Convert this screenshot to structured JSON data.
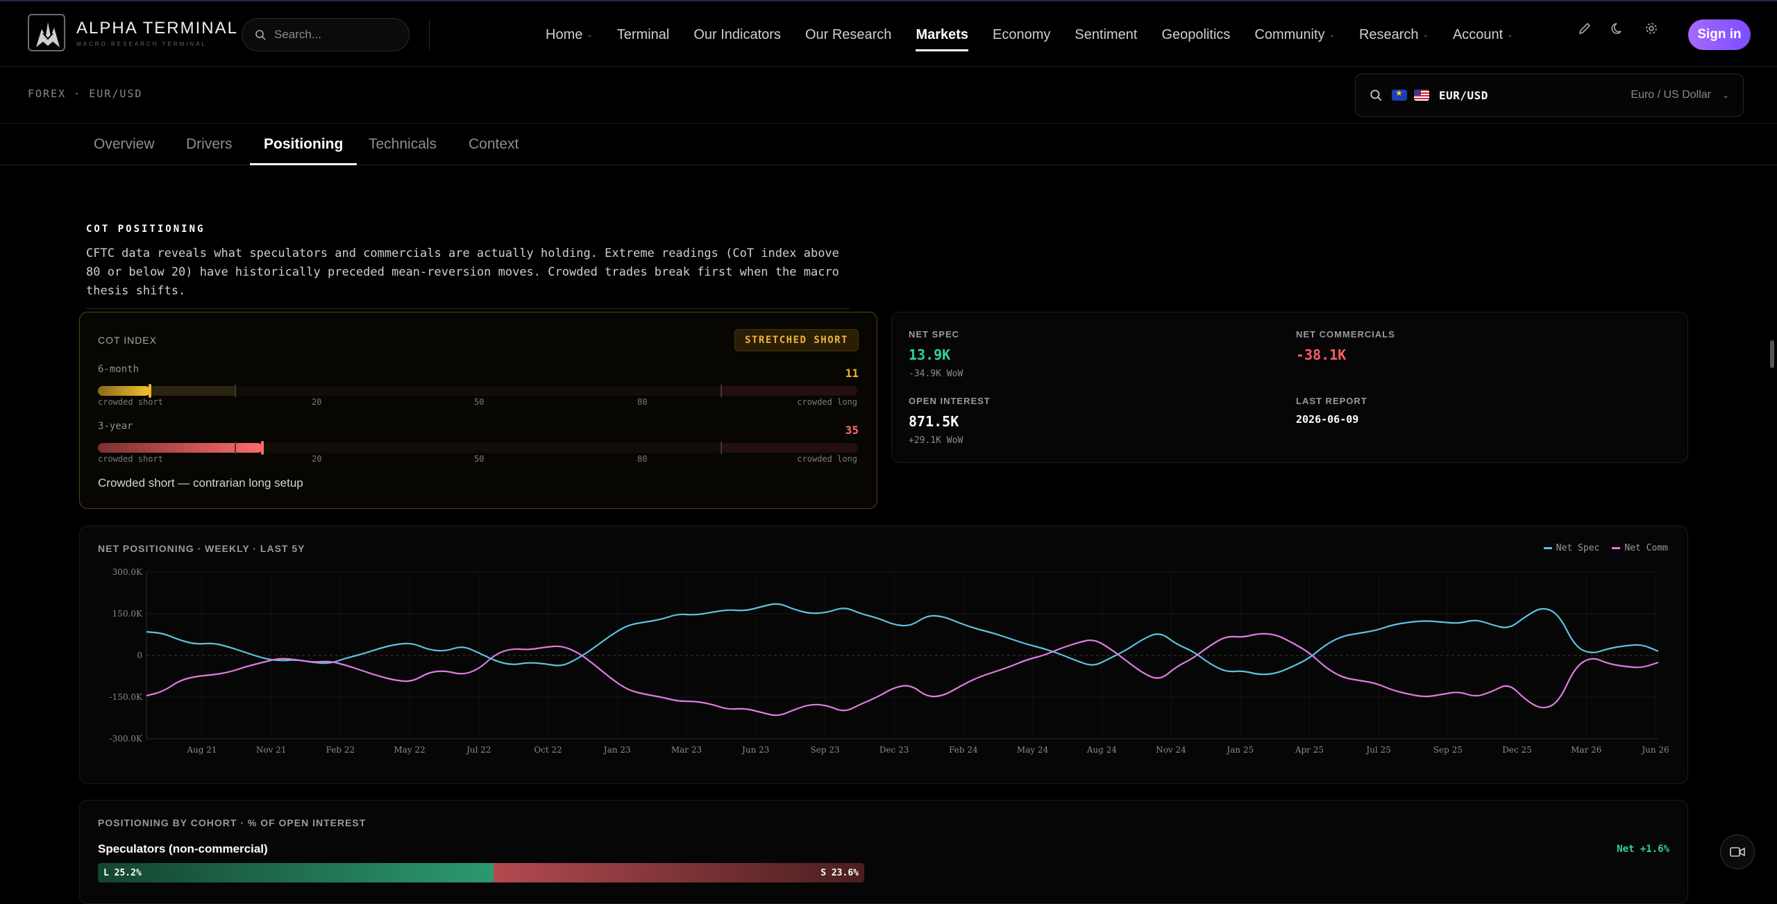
{
  "brand": {
    "title": "ALPHA TERMINAL",
    "subtitle": "MACRO RESEARCH TERMINAL"
  },
  "search": {
    "placeholder": "Search..."
  },
  "nav": [
    {
      "label": "Home",
      "dropdown": true
    },
    {
      "label": "Terminal",
      "dropdown": false
    },
    {
      "label": "Our Indicators",
      "dropdown": false
    },
    {
      "label": "Our Research",
      "dropdown": false
    },
    {
      "label": "Markets",
      "dropdown": false,
      "active": true
    },
    {
      "label": "Economy",
      "dropdown": false
    },
    {
      "label": "Sentiment",
      "dropdown": false
    },
    {
      "label": "Geopolitics",
      "dropdown": false
    },
    {
      "label": "Community",
      "dropdown": true
    },
    {
      "label": "Research",
      "dropdown": true
    },
    {
      "label": "Account",
      "dropdown": true
    }
  ],
  "header_icons": [
    "pencil-icon",
    "moon-icon",
    "gear-icon"
  ],
  "signin_label": "Sign in",
  "breadcrumb": "FOREX · EUR/USD",
  "pair": {
    "code": "EUR/USD",
    "name": "Euro / US Dollar"
  },
  "tabs": [
    {
      "label": "Overview"
    },
    {
      "label": "Drivers"
    },
    {
      "label": "Positioning",
      "active": true
    },
    {
      "label": "Technicals"
    },
    {
      "label": "Context"
    }
  ],
  "section": {
    "title": "COT POSITIONING",
    "description": "CFTC data reveals what speculators and commercials are actually holding. Extreme readings (CoT index above 80 or below 20) have historically preceded mean-reversion moves. Crowded trades break first when the macro thesis shifts."
  },
  "cot": {
    "title": "COT INDEX",
    "badge": "STRETCHED SHORT",
    "rows": [
      {
        "label": "6-month",
        "value": "11",
        "level": 11,
        "color": "#f0b429"
      },
      {
        "label": "3-year",
        "value": "35",
        "level": 35,
        "color": "#ff6b6b"
      }
    ],
    "scale": {
      "left": "crowded short",
      "t20": "20",
      "t50": "50",
      "t80": "80",
      "right": "crowded long"
    },
    "note": "Crowded short — contrarian long setup"
  },
  "stats": {
    "net_spec": {
      "label": "NET SPEC",
      "value": "13.9K",
      "sub": "-34.9K WoW",
      "color": "#2ed39a"
    },
    "net_comm": {
      "label": "NET COMMERCIALS",
      "value": "-38.1K",
      "color": "#ff5a67"
    },
    "open_interest": {
      "label": "OPEN INTEREST",
      "value": "871.5K",
      "sub": "+29.1K WoW"
    },
    "last_report": {
      "label": "LAST REPORT",
      "value": "2026-06-09"
    }
  },
  "chart_data": {
    "type": "line",
    "title": "NET POSITIONING · WEEKLY · LAST 5Y",
    "ylim": [
      -300,
      300
    ],
    "yticks": [
      "300.0K",
      "150.0K",
      "0",
      "-150.0K",
      "-300.0K"
    ],
    "x_labels": [
      "Aug 21",
      "Nov 21",
      "Feb 22",
      "May 22",
      "Jul 22",
      "Oct 22",
      "Jan 23",
      "Mar 23",
      "Jun 23",
      "Sep 23",
      "Dec 23",
      "Feb 24",
      "May 24",
      "Aug 24",
      "Nov 24",
      "Jan 25",
      "Apr 25",
      "Jul 25",
      "Sep 25",
      "Dec 25",
      "Mar 26",
      "Jun 26"
    ],
    "grid": true,
    "legend": "top-right",
    "series": [
      {
        "name": "Net Spec",
        "color": "#5bc3e0",
        "values": [
          85,
          80,
          55,
          40,
          45,
          30,
          10,
          -10,
          -20,
          -15,
          -25,
          -30,
          -10,
          5,
          25,
          40,
          45,
          20,
          15,
          35,
          10,
          -20,
          -35,
          -25,
          -30,
          -40,
          -10,
          30,
          75,
          110,
          120,
          130,
          150,
          145,
          155,
          165,
          160,
          175,
          190,
          165,
          150,
          155,
          175,
          150,
          135,
          110,
          105,
          145,
          140,
          115,
          95,
          80,
          60,
          40,
          25,
          5,
          -20,
          -40,
          -10,
          20,
          60,
          85,
          40,
          15,
          -30,
          -60,
          -55,
          -70,
          -65,
          -40,
          -10,
          40,
          70,
          80,
          90,
          110,
          120,
          125,
          120,
          115,
          130,
          110,
          95,
          140,
          175,
          150,
          30,
          5,
          25,
          35,
          40,
          15
        ]
      },
      {
        "name": "Net Comm",
        "color": "#e07be0",
        "values": [
          -145,
          -130,
          -90,
          -75,
          -70,
          -60,
          -40,
          -25,
          -10,
          -15,
          -25,
          -20,
          -35,
          -55,
          -75,
          -90,
          -95,
          -60,
          -55,
          -70,
          -50,
          5,
          25,
          20,
          30,
          35,
          10,
          -35,
          -85,
          -125,
          -140,
          -150,
          -165,
          -165,
          -175,
          -195,
          -190,
          -205,
          -220,
          -195,
          -175,
          -180,
          -205,
          -175,
          -150,
          -115,
          -105,
          -150,
          -145,
          -110,
          -80,
          -60,
          -40,
          -15,
          0,
          25,
          45,
          60,
          25,
          -20,
          -65,
          -90,
          -40,
          -10,
          35,
          70,
          65,
          80,
          75,
          45,
          10,
          -45,
          -80,
          -90,
          -100,
          -125,
          -140,
          -150,
          -140,
          -130,
          -150,
          -130,
          -100,
          -160,
          -195,
          -170,
          -40,
          -5,
          -30,
          -40,
          -45,
          -25
        ]
      }
    ]
  },
  "cohort": {
    "title": "POSITIONING BY COHORT · % OF OPEN INTEREST",
    "name": "Speculators (non-commercial)",
    "net": "Net +1.6%",
    "long": "L 25.2%",
    "short": "S 23.6%",
    "long_pct": 25.2,
    "short_pct": 23.6
  }
}
